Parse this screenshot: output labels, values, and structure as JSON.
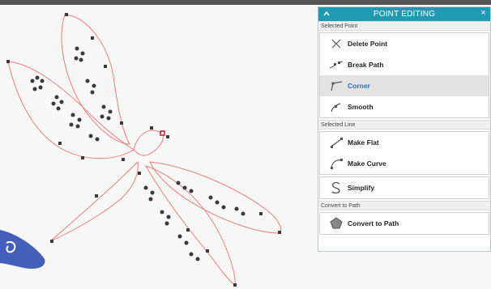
{
  "panel": {
    "title": "POINT EDITING",
    "close_glyph": "×",
    "sections": {
      "selected_point": {
        "header": "Selected Point",
        "items": [
          {
            "label": "Delete Point",
            "icon": "x-icon"
          },
          {
            "label": "Break Path",
            "icon": "break-path-icon"
          },
          {
            "label": "Corner",
            "icon": "corner-icon",
            "selected": true
          },
          {
            "label": "Smooth",
            "icon": "smooth-icon"
          }
        ]
      },
      "selected_line": {
        "header": "Selected Line",
        "items": [
          {
            "label": "Make Flat",
            "icon": "make-flat-icon"
          },
          {
            "label": "Make Curve",
            "icon": "make-curve-icon"
          }
        ]
      },
      "simplify": {
        "label": "Simplify",
        "icon": "simplify-icon"
      },
      "convert_to_path": {
        "header": "Convert to Path",
        "button": {
          "label": "Convert to Path",
          "icon": "pentagon-icon"
        }
      }
    }
  },
  "colors": {
    "accent": "#1f9ab0",
    "selected_text": "#2c6fb8",
    "path_stroke": "#e4807c",
    "node_fill": "#3a3a3a",
    "selected_node": "#d4132d",
    "blue_shape": "#2f4eb3"
  }
}
